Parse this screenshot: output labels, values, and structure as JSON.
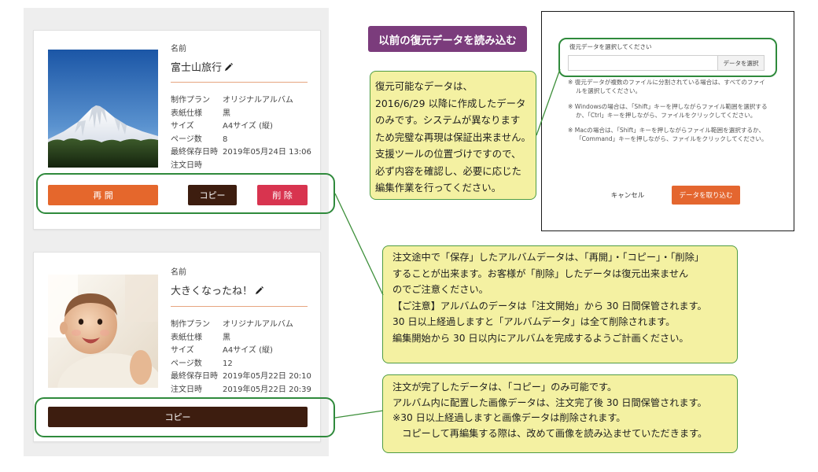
{
  "albums": [
    {
      "name_label": "名前",
      "title": "富士山旅行",
      "details": [
        {
          "label": "制作プラン",
          "value": "オリジナルアルバム"
        },
        {
          "label": "表紙仕様",
          "value": "黒"
        },
        {
          "label": "サイズ",
          "value": "A4サイズ (縦)"
        },
        {
          "label": "ページ数",
          "value": "8"
        },
        {
          "label": "最終保存日時",
          "value": "2019年05月24日 13:06"
        },
        {
          "label": "注文日時",
          "value": ""
        }
      ],
      "buttons": {
        "resume": "再 開",
        "copy": "コピー",
        "delete": "削 除"
      }
    },
    {
      "name_label": "名前",
      "title": "大きくなったね！",
      "details": [
        {
          "label": "制作プラン",
          "value": "オリジナルアルバム"
        },
        {
          "label": "表紙仕様",
          "value": "黒"
        },
        {
          "label": "サイズ",
          "value": "A4サイズ (縦)"
        },
        {
          "label": "ページ数",
          "value": "12"
        },
        {
          "label": "最終保存日時",
          "value": "2019年05月22日 20:10"
        },
        {
          "label": "注文日時",
          "value": "2019年05月22日 20:39"
        }
      ],
      "buttons": {
        "copy": "コピー"
      }
    }
  ],
  "restore_button": {
    "label": "以前の復元データを読み込む"
  },
  "restore_dialog": {
    "file_label": "復元データを選択してください",
    "select_button": "データを選択",
    "notes": [
      "※ 復元データが複数のファイルに分割されている場合は、すべてのファイルを選択してください。",
      "※ Windowsの場合は、「Shift」キーを押しながらファイル範囲を選択するか、「Ctrl」キーを押しながら、ファイルをクリックしてください。",
      "※ Macの場合は、「Shift」キーを押しながらファイル範囲を選択するか、「Command」キーを押しながら、ファイルをクリックしてください。"
    ],
    "cancel_button": "キャンセル",
    "import_button": "データを取り込む"
  },
  "callouts": {
    "restore_info": [
      "復元可能なデータは、",
      "2016/6/29 以降に作成したデータ",
      "のみです。システムが異なります",
      "ため完璧な再現は保証出来ません。",
      "支援ツールの位置づけですので、",
      "必ず内容を確認し、必要に応じた",
      "編集作業を行ってください。"
    ],
    "saved_album_info": [
      "注文途中で「保存」したアルバムデータは、「再開」・「コピー」・「削除」",
      "することが出来ます。お客様が「削除」したデータは復元出来ません",
      "のでご注意ください。",
      "【ご注意】アルバムのデータは「注文開始」から 30 日間保管されます。",
      "30 日以上経過しますと「アルバムデータ」は全て削除されます。",
      "編集開始から 30 日以内にアルバムを完成するようご計画ください。"
    ],
    "ordered_album_info": [
      "注文が完了したデータは、「コピー」のみ可能です。",
      "アルバム内に配置した画像データは、注文完了後 30 日間保管されます。",
      "※30 日以上経過しますと画像データは削除されます。",
      "　コピーして再編集する際は、改めて画像を読み込ませていただきます。"
    ]
  },
  "icons": {
    "edit_title": "pencil-icon"
  },
  "colors": {
    "resume_button": "#e5672c",
    "copy_button": "#3d1d0f",
    "delete_button": "#d8344f",
    "restore_button": "#7b3c7c",
    "import_button": "#e4662f",
    "callout_fill": "#f4f1a2",
    "highlight_outline": "#2f8a3c"
  }
}
